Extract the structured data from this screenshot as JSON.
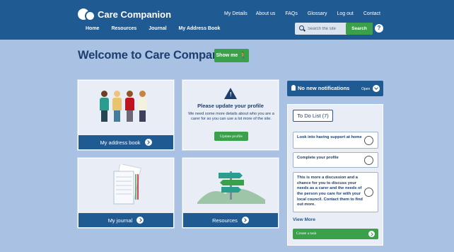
{
  "header": {
    "logo_text": "Care Companion",
    "top_links": [
      "My Details",
      "About us",
      "FAQs",
      "Glossary",
      "Log out",
      "Contact"
    ],
    "main_links": [
      "Home",
      "Resources",
      "Journal",
      "My Address Book"
    ],
    "search_placeholder": "Search the site",
    "search_button": "Search",
    "help_label": "?"
  },
  "welcome": {
    "title": "Welcome to Care Companion",
    "show_me_label": "Show me"
  },
  "cards": {
    "address_book": "My address book",
    "update_title": "Please update your profile",
    "update_text": "We need some more details about who you are a carer for so you can use a lot more of the site.",
    "update_button": "Update profile",
    "journal": "My journal",
    "resources": "Resources"
  },
  "notifications": {
    "text": "No new notifications",
    "open_label": "Open"
  },
  "todo": {
    "title": "To Do List (7)",
    "tasks": [
      "Look into having support at home",
      "Complete your profile",
      "This is more a discussion and a chance for you to discuss your needs as a carer and the needs of the person you care for with your local council. Contact them to find out more."
    ],
    "view_more": "View More",
    "create_task": "Create a task"
  },
  "colors": {
    "header_blue": "#1f5a93",
    "accent_green": "#3aa04a",
    "page_background": "#a9c1e2",
    "heading_navy": "#1c3f6e"
  },
  "icons": [
    "logo-icon",
    "search-icon",
    "help-icon",
    "walking-person-icon",
    "arrow-right-icon",
    "warning-icon",
    "bell-icon",
    "chevron-down-icon",
    "plus-icon"
  ]
}
